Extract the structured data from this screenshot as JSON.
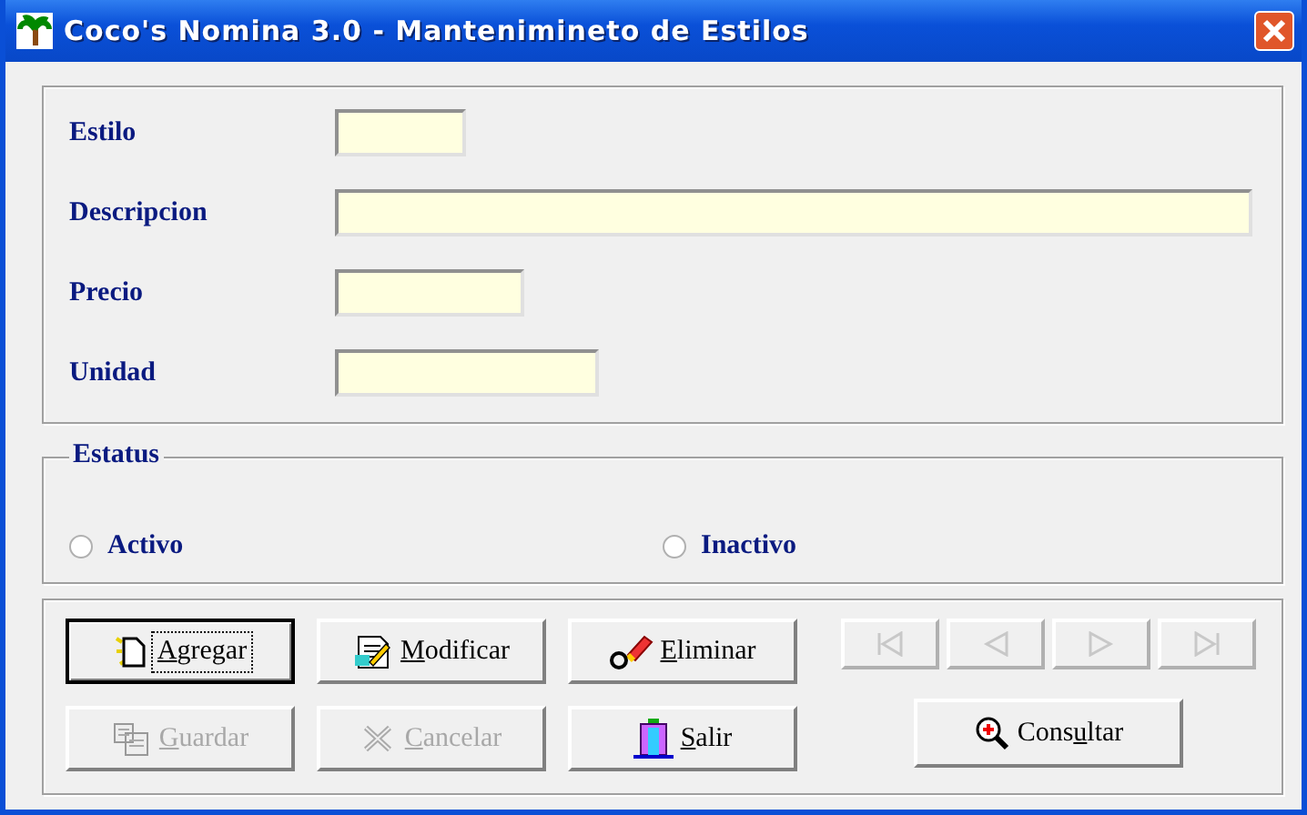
{
  "window": {
    "title": "Coco's Nomina 3.0 - Mantenimineto de Estilos"
  },
  "fields": [
    {
      "label": "Estilo"
    },
    {
      "label": "Descripcion"
    },
    {
      "label": "Precio"
    },
    {
      "label": "Unidad"
    }
  ],
  "estatus": {
    "title": "Estatus",
    "options": [
      {
        "label": "Activo",
        "selected": false
      },
      {
        "label": "Inactivo",
        "selected": false
      }
    ]
  },
  "buttons": [
    {
      "kind": "agregar",
      "key": "A",
      "post": "gregar",
      "disabled": false,
      "focused": true
    },
    {
      "kind": "modificar",
      "key": "M",
      "post": "odificar",
      "disabled": false,
      "focused": false
    },
    {
      "kind": "eliminar",
      "key": "E",
      "post": "liminar",
      "disabled": false,
      "focused": false
    },
    {
      "kind": "guardar",
      "key": "G",
      "post": "uardar",
      "disabled": true,
      "focused": false
    },
    {
      "kind": "cancelar",
      "key": "C",
      "post": "ancelar",
      "disabled": true,
      "focused": false
    },
    {
      "kind": "salir",
      "key": "S",
      "post": "alir",
      "disabled": false,
      "focused": false
    }
  ],
  "navigation": [
    {
      "kind": "first",
      "disabled": true
    },
    {
      "kind": "prev",
      "disabled": true
    },
    {
      "kind": "next",
      "disabled": true
    },
    {
      "kind": "last",
      "disabled": true
    }
  ],
  "consultar": {
    "pre": "Cons",
    "key": "u",
    "post": "ltar",
    "disabled": false
  }
}
